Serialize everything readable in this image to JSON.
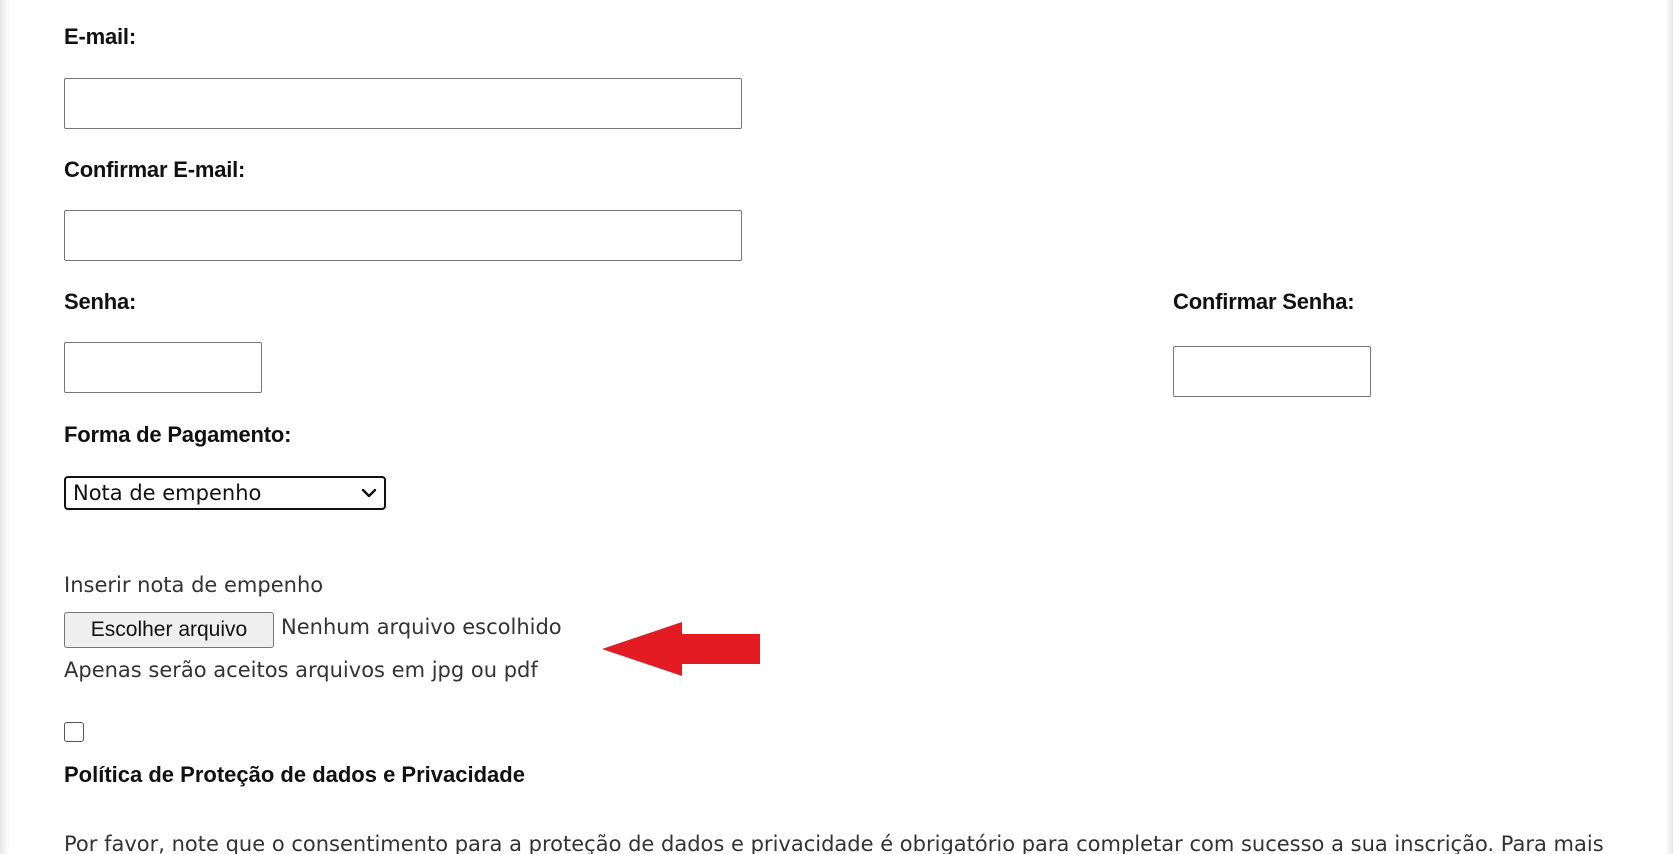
{
  "form": {
    "email_label": "E-mail:",
    "email_value": "",
    "confirm_email_label": "Confirmar E-mail:",
    "confirm_email_value": "",
    "password_label": "Senha:",
    "password_value": "",
    "confirm_password_label": "Confirmar Senha:",
    "confirm_password_value": "",
    "payment_label": "Forma de Pagamento:",
    "payment_selected": "Nota de empenho",
    "upload_label": "Inserir nota de empenho",
    "file_button_label": "Escolher arquivo",
    "file_status": "Nenhum arquivo escolhido",
    "file_hint": "Apenas serão aceitos arquivos em jpg ou pdf",
    "consent_checked": false,
    "privacy_title": "Política de Proteção de dados e Privacidade",
    "consent_text": "Por favor, note que o consentimento para a proteção de dados e privacidade é obrigatório para completar com sucesso a sua inscrição. Para mais"
  },
  "icons": {
    "select_chevron": "chevron-down-icon",
    "annotation_arrow": "arrow-left-icon"
  },
  "colors": {
    "annotation_arrow": "#e31b23",
    "input_border": "#767676",
    "button_background": "#efefef"
  }
}
